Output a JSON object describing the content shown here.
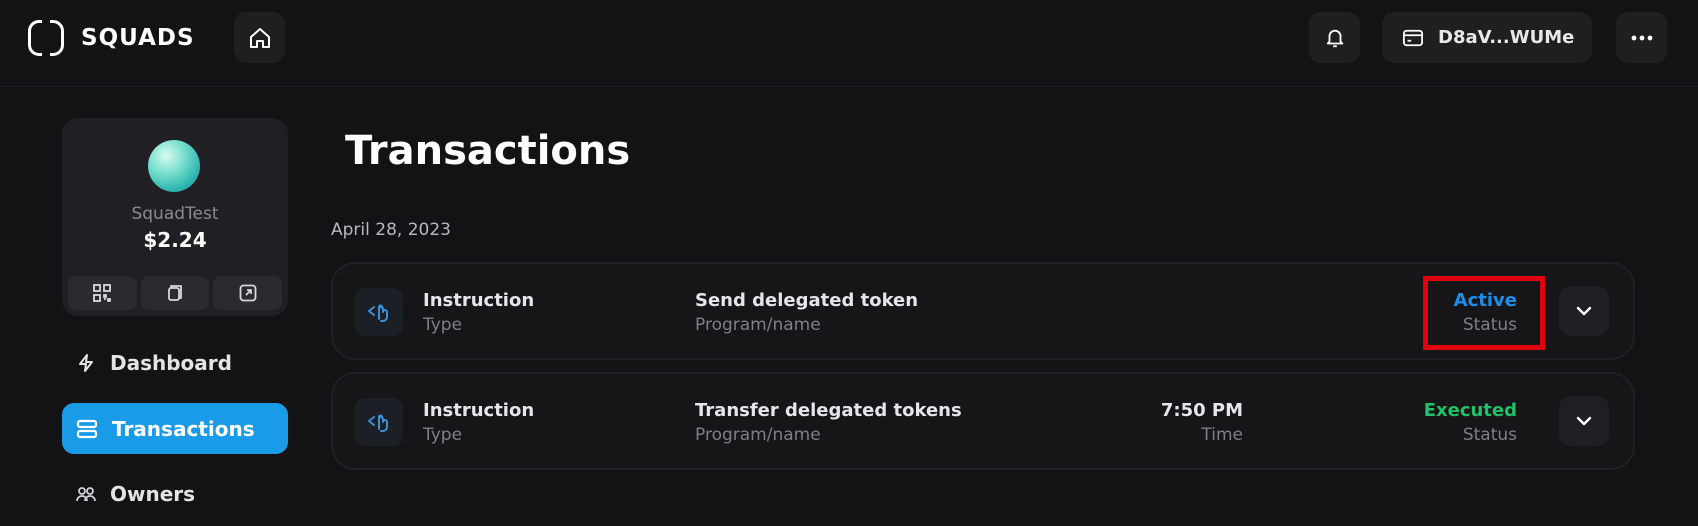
{
  "header": {
    "logo_text": "SQUADS",
    "wallet_label": "D8aV...WUMe",
    "icons": {
      "home": "home-icon",
      "bell": "bell-icon",
      "wallet": "wallet-icon",
      "more": "more-icon"
    }
  },
  "sidebar": {
    "squad": {
      "name": "SquadTest",
      "balance": "$2.24",
      "actions": [
        "qr-code-icon",
        "copy-icon",
        "external-link-icon"
      ]
    },
    "nav": [
      {
        "label": "Dashboard",
        "icon": "lightning-icon",
        "active": false
      },
      {
        "label": "Transactions",
        "icon": "stack-icon",
        "active": true
      },
      {
        "label": "Owners",
        "icon": "users-icon",
        "active": false
      }
    ]
  },
  "main": {
    "title": "Transactions",
    "date_group": "April 28, 2023",
    "transactions": [
      {
        "type_value": "Instruction",
        "type_label": "Type",
        "program_value": "Send delegated token",
        "program_label": "Program/name",
        "time_value": "",
        "time_label": "",
        "status_value": "Active",
        "status_label": "Status",
        "status_color": "#1d8ee8"
      },
      {
        "type_value": "Instruction",
        "type_label": "Type",
        "program_value": "Transfer delegated tokens",
        "program_label": "Program/name",
        "time_value": "7:50 PM",
        "time_label": "Time",
        "status_value": "Executed",
        "status_label": "Status",
        "status_color": "#20c168"
      }
    ]
  },
  "colors": {
    "background": "#131315",
    "accent": "#1a9be7",
    "highlight": "#e0000f"
  }
}
